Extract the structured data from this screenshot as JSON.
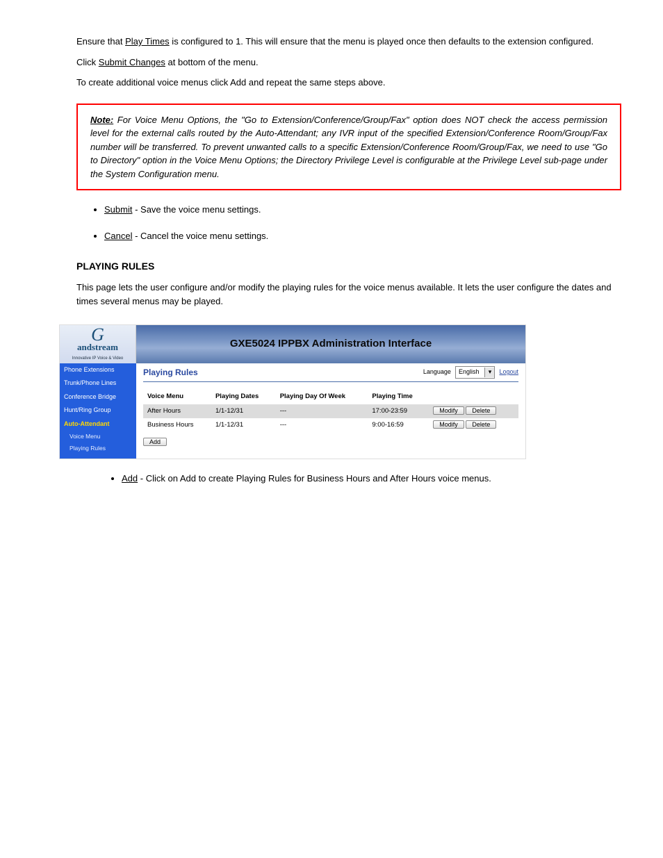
{
  "doc": {
    "para1_prefix": "Ensure that ",
    "para1_term": "Play Times",
    "para1_suffix": " is configured to 1. This will ensure that the menu is played once then defaults to the extension configured.",
    "para2_prefix": "Click ",
    "para2_term": "Submit Changes",
    "para2_suffix": " at bottom of the menu.",
    "para3": "To create additional voice menus click Add and repeat the same steps above.",
    "note_label": "Note:",
    "note_body": " For Voice Menu Options, the \"Go to Extension/Conference/Group/Fax\" option does NOT check the access permission level for the external calls routed by the Auto-Attendant; any IVR input of the specified Extension/Conference Room/Group/Fax number will be transferred. To prevent unwanted calls to a specific Extension/Conference Room/Group/Fax, we need to use \"Go to Directory\" option in the Voice Menu Options; the Directory Privilege Level is configurable at the Privilege Level sub-page under the System Configuration menu.",
    "submit_term": "Submit",
    "submit_body": " - Save the voice menu settings.",
    "cancel_term": "Cancel",
    "cancel_body": " - Cancel the voice menu settings.",
    "playing_rules_head": "PLAYING RULES",
    "playing_rules_body": "This page lets the user configure and/or modify the playing rules for the voice menus available. It lets the user configure the dates and times several menus may be played.",
    "add_term": "Add",
    "add_body": " - Click on Add to create Playing Rules for Business Hours and After Hours voice menus."
  },
  "app": {
    "logo_brand": "andstream",
    "logo_tag": "Innovative IP Voice & Video",
    "title": "GXE5024 IPPBX Administration Interface",
    "sidebar": {
      "items": [
        {
          "label": "Phone Extensions"
        },
        {
          "label": "Trunk/Phone Lines"
        },
        {
          "label": "Conference Bridge"
        },
        {
          "label": "Hunt/Ring Group"
        },
        {
          "label": "Auto-Attendant",
          "active": true
        },
        {
          "label": "Voice Menu",
          "sub": true
        },
        {
          "label": "Playing Rules",
          "sub": true
        }
      ]
    },
    "content_title": "Playing Rules",
    "lang_label": "Language",
    "lang_value": "English",
    "logout": "Logout",
    "table": {
      "cols": [
        "Voice Menu",
        "Playing Dates",
        "Playing Day Of Week",
        "Playing Time"
      ],
      "rows": [
        {
          "menu": "After Hours",
          "dates": "1/1-12/31",
          "dow": "---",
          "time": "17:00-23:59"
        },
        {
          "menu": "Business Hours",
          "dates": "1/1-12/31",
          "dow": "---",
          "time": "9:00-16:59"
        }
      ]
    },
    "modify_label": "Modify",
    "delete_label": "Delete",
    "add_label": "Add"
  }
}
